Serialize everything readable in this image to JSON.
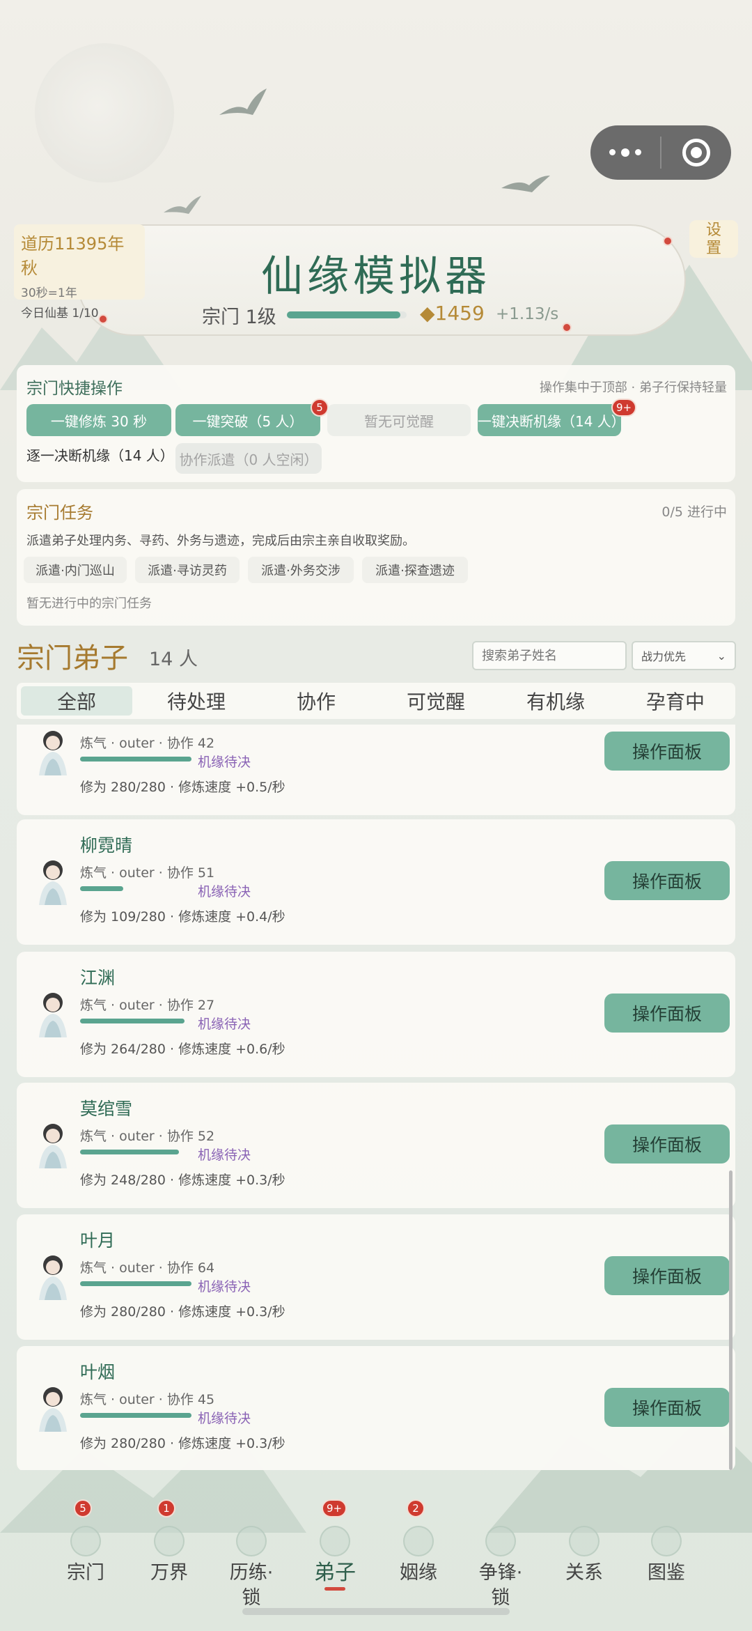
{
  "header": {
    "year": "道历11395年秋",
    "time_rate": "30秒=1年",
    "daily": "今日仙基 1/10",
    "app_title": "仙缘模拟器",
    "sect_level": "宗门 1级",
    "sect_progress": 0.95,
    "spirit_stones": "◆1459",
    "stone_rate": "+1.13/s",
    "settings_label": "设置"
  },
  "quick_ops": {
    "title": "宗门快捷操作",
    "hint": "操作集中于顶部 · 弟子行保持轻量",
    "buttons": [
      {
        "label": "一键修炼 30 秒",
        "enabled": true,
        "badge": ""
      },
      {
        "label": "一键突破（5 人）",
        "enabled": true,
        "badge": "5"
      },
      {
        "label": "暂无可觉醒",
        "enabled": false,
        "badge": ""
      },
      {
        "label": "一键决断机缘（14 人）",
        "enabled": true,
        "badge": "9+"
      }
    ],
    "row2": [
      {
        "label": "逐一决断机缘（14 人）",
        "enabled": true
      },
      {
        "label": "协作派遣（0 人空闲）",
        "enabled": false
      }
    ]
  },
  "tasks": {
    "title": "宗门任务",
    "status": "0/5 进行中",
    "desc": "派遣弟子处理内务、寻药、外务与遗迹，完成后由宗主亲自收取奖励。",
    "chips": [
      "派遣·内门巡山",
      "派遣·寻访灵药",
      "派遣·外务交涉",
      "派遣·探查遗迹"
    ],
    "empty": "暂无进行中的宗门任务"
  },
  "disciples": {
    "title": "宗门弟子",
    "count": "14 人",
    "search_placeholder": "搜索弟子姓名",
    "sort": "战力优先",
    "tabs": [
      "全部",
      "待处理",
      "协作",
      "可觉醒",
      "有机缘",
      "孕育中"
    ],
    "active_tab": 0,
    "op_label": "操作面板",
    "fate_label": "机缘待决",
    "list": [
      {
        "name": "",
        "meta": "炼气 · outer · 协作 42",
        "progress": "修为 280/280 · 修炼速度 +0.5/秒",
        "ratio": 1.0
      },
      {
        "name": "柳霓晴",
        "meta": "炼气 · outer · 协作 51",
        "progress": "修为 109/280 · 修炼速度 +0.4/秒",
        "ratio": 0.39
      },
      {
        "name": "江渊",
        "meta": "炼气 · outer · 协作 27",
        "progress": "修为 264/280 · 修炼速度 +0.6/秒",
        "ratio": 0.94
      },
      {
        "name": "莫绾雪",
        "meta": "炼气 · outer · 协作 52",
        "progress": "修为 248/280 · 修炼速度 +0.3/秒",
        "ratio": 0.89
      },
      {
        "name": "叶月",
        "meta": "炼气 · outer · 协作 64",
        "progress": "修为 280/280 · 修炼速度 +0.3/秒",
        "ratio": 1.0
      },
      {
        "name": "叶烟",
        "meta": "炼气 · outer · 协作 45",
        "progress": "修为 280/280 · 修炼速度 +0.3/秒",
        "ratio": 1.0
      }
    ]
  },
  "nav": [
    {
      "label": "宗门",
      "badge": "5",
      "icon": "pagoda-icon"
    },
    {
      "label": "万界",
      "badge": "1",
      "icon": "gate-icon"
    },
    {
      "label": "历练·\n锁",
      "badge": "",
      "icon": "compass-icon"
    },
    {
      "label": "弟子",
      "badge": "9+",
      "icon": "disciple-icon",
      "active": true
    },
    {
      "label": "姻缘",
      "badge": "2",
      "icon": "ring-icon"
    },
    {
      "label": "争锋·\n锁",
      "badge": "",
      "icon": "sword-icon"
    },
    {
      "label": "关系",
      "badge": "",
      "icon": "link-icon"
    },
    {
      "label": "图鉴",
      "badge": "",
      "icon": "book-icon"
    }
  ],
  "colors": {
    "accent": "#76b59e",
    "gold": "#a67a2f",
    "badge": "#cf3a2f",
    "fate": "#8a63b5"
  }
}
